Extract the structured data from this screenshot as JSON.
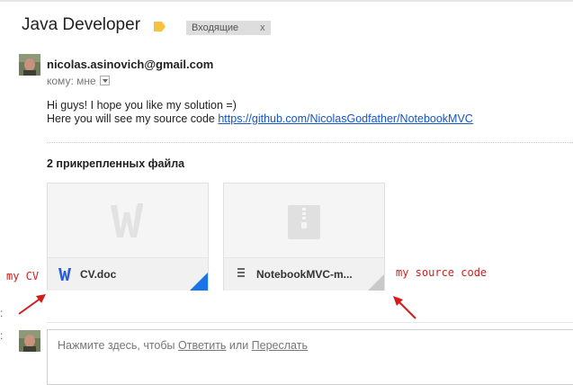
{
  "thread": {
    "subject": "Java Developer",
    "label_chip": "Входящие",
    "label_close": "x"
  },
  "message": {
    "sender": "nicolas.asinovich@gmail.com",
    "to_label": "кому: мне",
    "body_line1": "Hi guys! I hope you like my solution =)",
    "body_line2_prefix": "Here you will see my source code ",
    "body_link": "https://github.com/NicolasGodfather/NotebookMVC"
  },
  "attachments": {
    "title": "2 прикрепленных файла",
    "items": [
      {
        "name": "CV.doc",
        "type_icon": "word-icon",
        "preview_icon": "word-w-preview-icon"
      },
      {
        "name": "NotebookMVC-m...",
        "type_icon": "archive-icon",
        "preview_icon": "zip-preview-icon"
      }
    ]
  },
  "annotations": {
    "left": "my CV",
    "right": "my source code"
  },
  "reply": {
    "prefix": "Нажмите здесь, чтобы ",
    "reply_link": "Ответить",
    "middle": " или ",
    "forward_link": "Переслать"
  },
  "colors": {
    "link": "#1155cc",
    "annotation": "#d21d1d",
    "label_tag": "#f6c33e",
    "word_blue": "#1a73e8"
  }
}
